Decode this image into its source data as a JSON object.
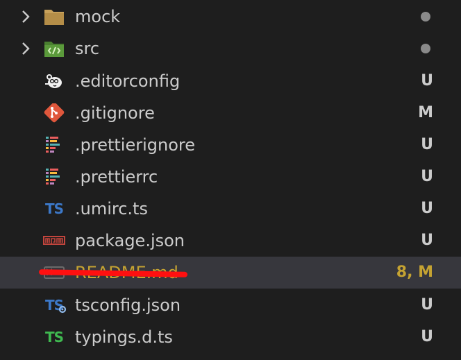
{
  "explorer": {
    "items": [
      {
        "name": "mock",
        "kind": "folder",
        "status": "dot",
        "badge": ""
      },
      {
        "name": "src",
        "kind": "folder-src",
        "status": "dot",
        "badge": ""
      },
      {
        "name": ".editorconfig",
        "kind": "editorconfig",
        "status": "untracked",
        "badge": "U"
      },
      {
        "name": ".gitignore",
        "kind": "git",
        "status": "modified",
        "badge": "M"
      },
      {
        "name": ".prettierignore",
        "kind": "prettier",
        "status": "untracked",
        "badge": "U"
      },
      {
        "name": ".prettierrc",
        "kind": "prettier",
        "status": "untracked",
        "badge": "U"
      },
      {
        "name": ".umirc.ts",
        "kind": "ts",
        "status": "untracked",
        "badge": "U"
      },
      {
        "name": "package.json",
        "kind": "npm",
        "status": "untracked",
        "badge": "U"
      },
      {
        "name": "README.md",
        "kind": "markdown",
        "status": "modified",
        "badge": "8, M"
      },
      {
        "name": "tsconfig.json",
        "kind": "tsconfig",
        "status": "untracked",
        "badge": "U"
      },
      {
        "name": "typings.d.ts",
        "kind": "dts",
        "status": "untracked",
        "badge": "U"
      }
    ],
    "ts_icon_text": "TS"
  },
  "colors": {
    "background": "#1e1e1e",
    "selected": "#37373d",
    "text": "#cccccc",
    "modified": "#c5a332",
    "ts_blue": "#3c78c8",
    "dts_green": "#3fb950",
    "folder": "#c8a15a",
    "src_folder": "#5b9a3b",
    "git": "#e0573c",
    "npm": "#c2453d",
    "annotation": "#ff1010"
  }
}
